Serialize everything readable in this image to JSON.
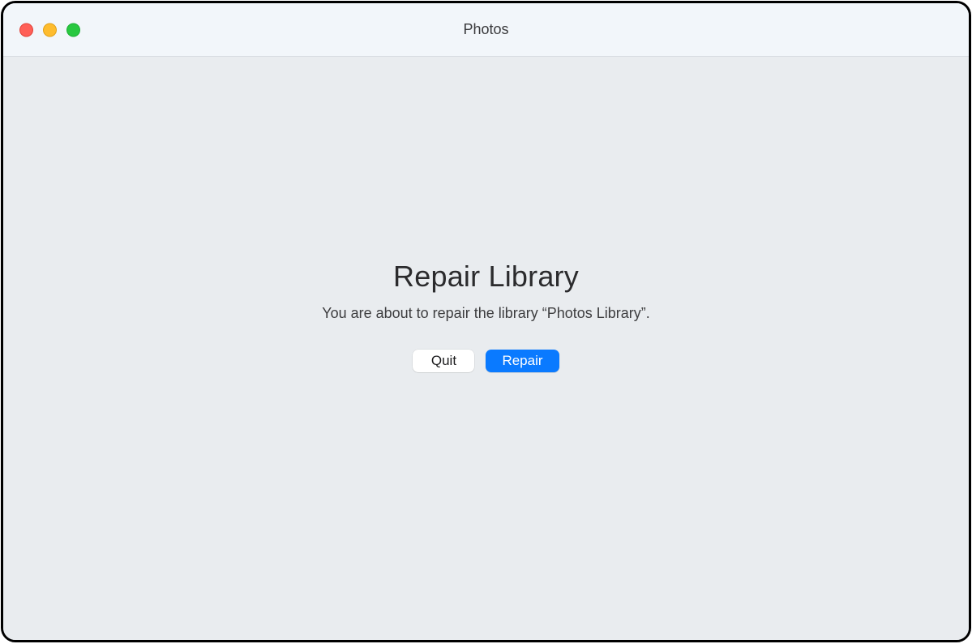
{
  "window": {
    "title": "Photos"
  },
  "dialog": {
    "heading": "Repair Library",
    "subtext": "You are about to repair the library “Photos Library”.",
    "quit_label": "Quit",
    "repair_label": "Repair"
  }
}
